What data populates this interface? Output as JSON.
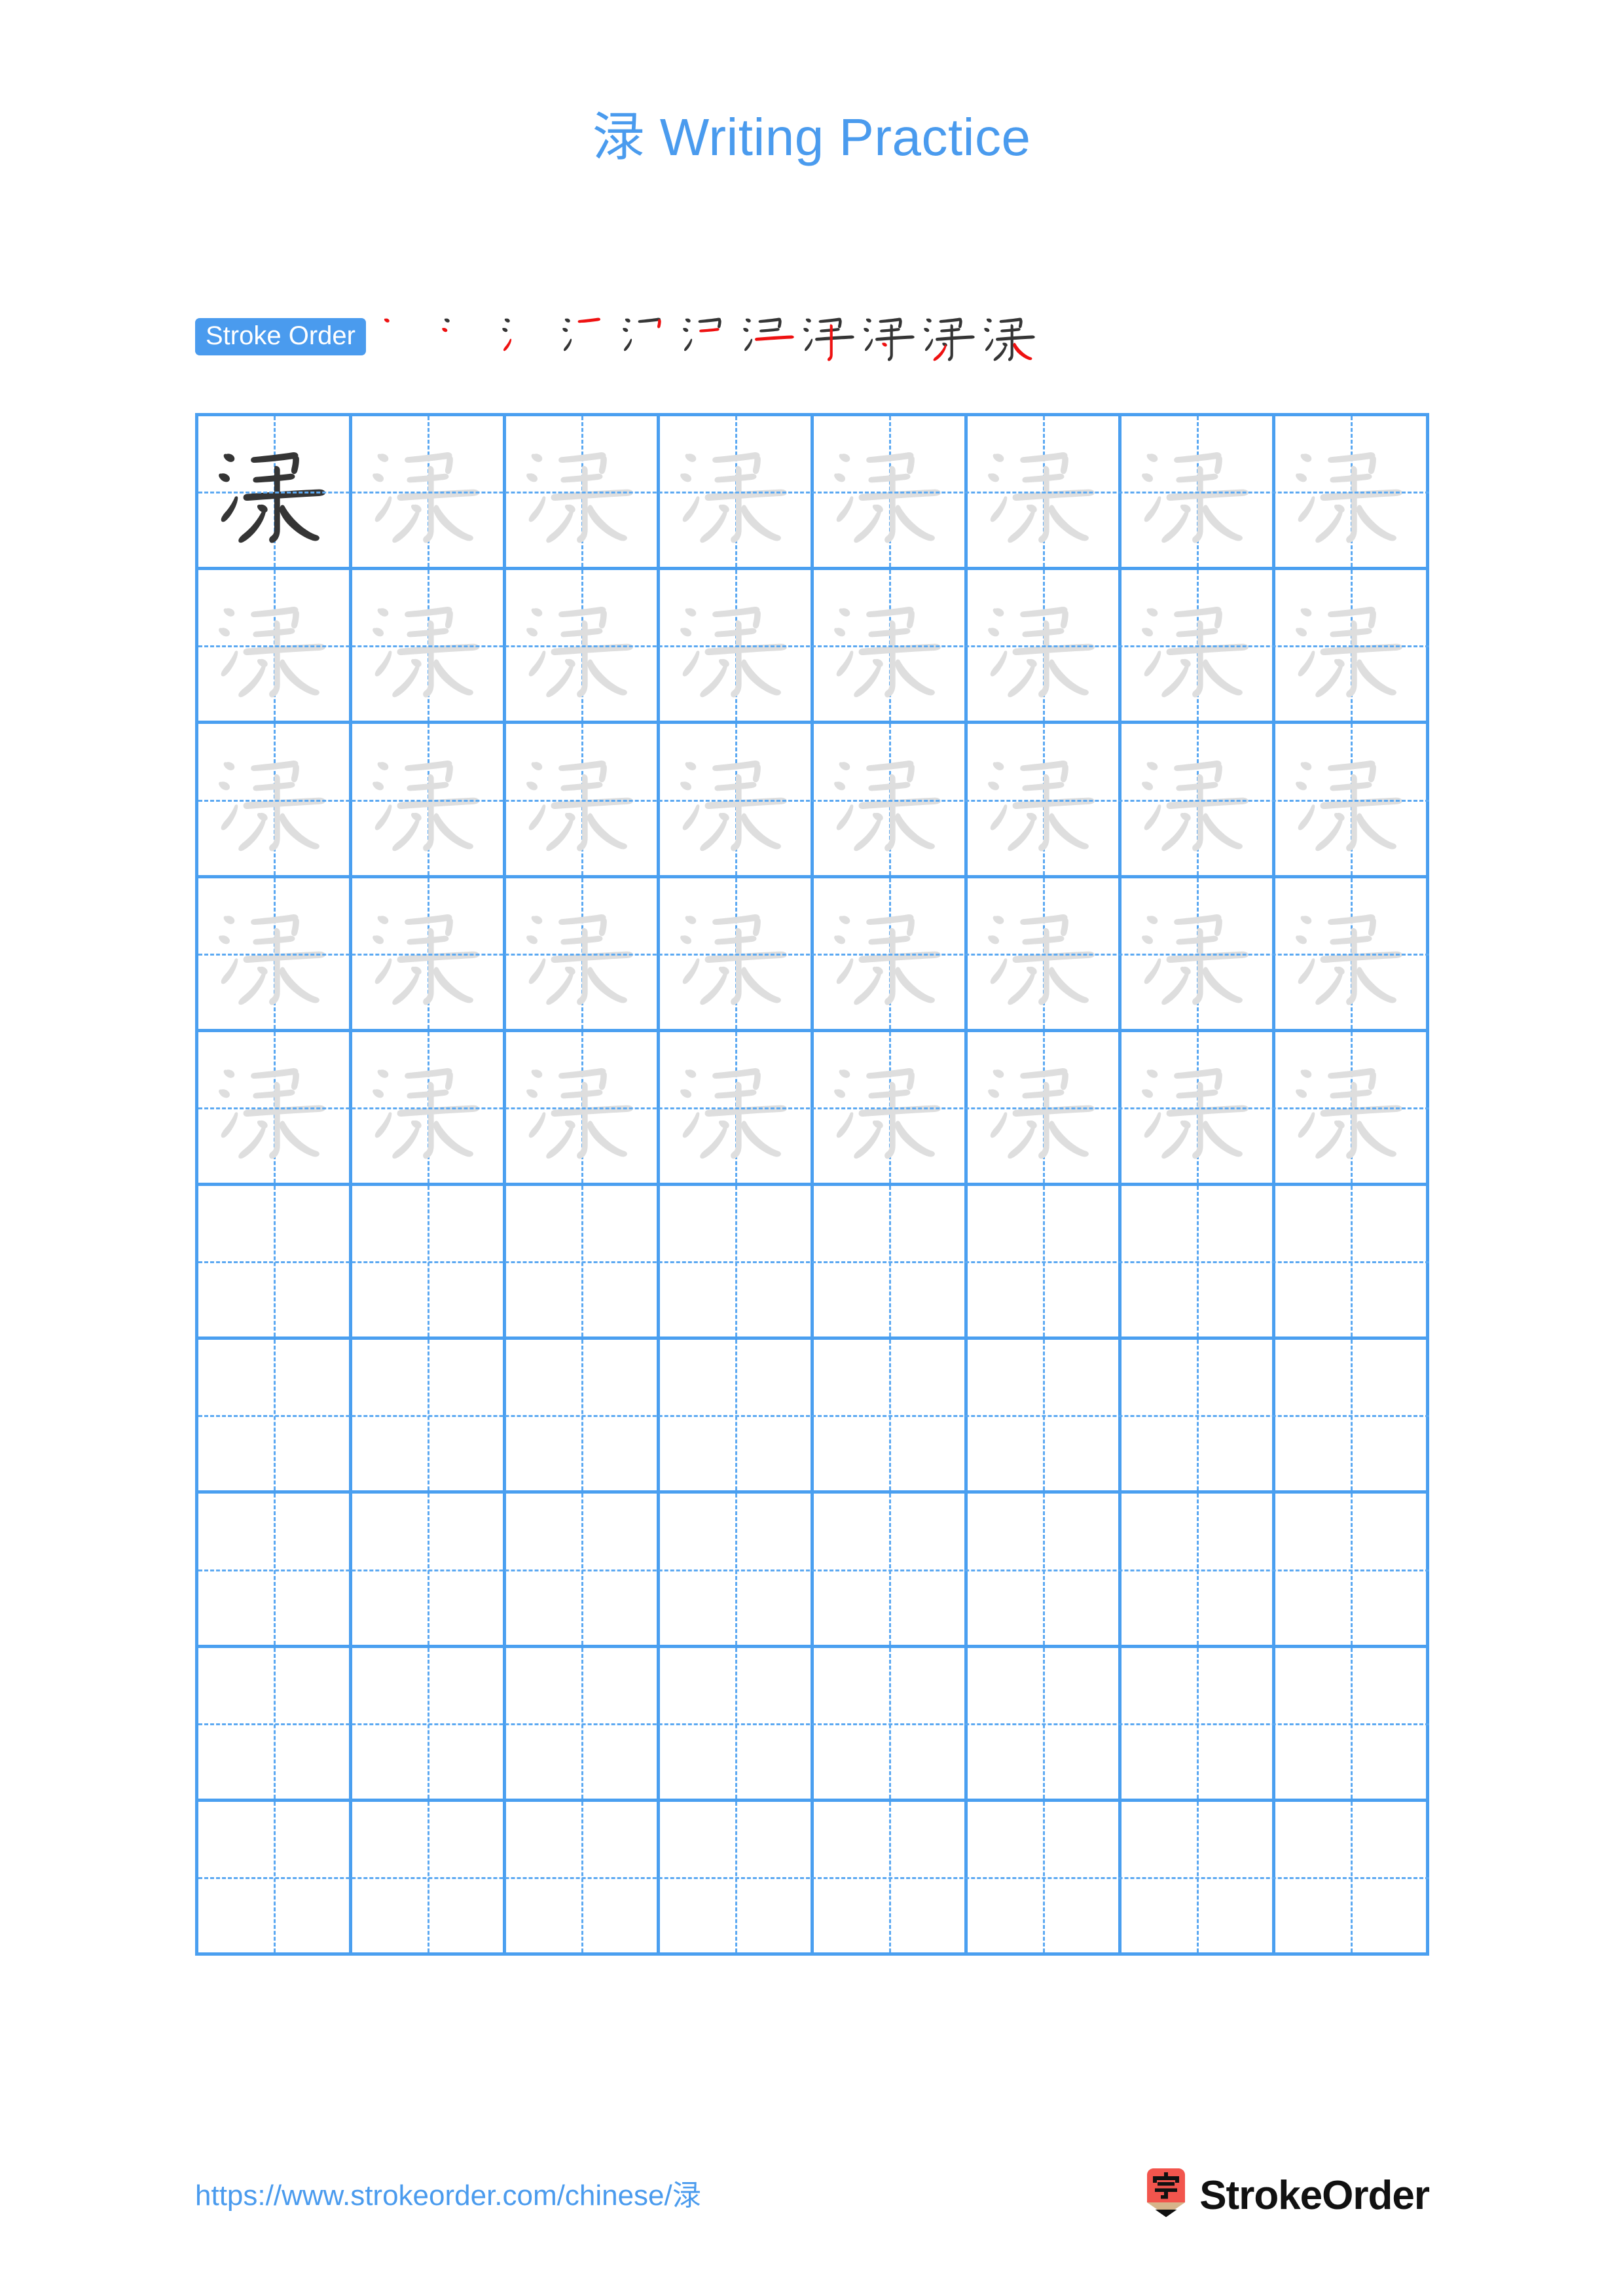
{
  "document": {
    "character": "渌",
    "title": "渌 Writing Practice",
    "title_color": "#4A9BEE",
    "page_background": "#ffffff"
  },
  "stroke_order": {
    "badge_label": "Stroke Order",
    "badge_background": "#4A9BEE",
    "badge_text_color": "#ffffff",
    "new_stroke_color": "#ee1111",
    "existing_stroke_color": "#353535",
    "total_strokes": 11,
    "stages": [
      {
        "index": 1,
        "strokes_shown": 1,
        "new_stroke": 1
      },
      {
        "index": 2,
        "strokes_shown": 2,
        "new_stroke": 2
      },
      {
        "index": 3,
        "strokes_shown": 3,
        "new_stroke": 3
      },
      {
        "index": 4,
        "strokes_shown": 4,
        "new_stroke": 4
      },
      {
        "index": 5,
        "strokes_shown": 5,
        "new_stroke": 5
      },
      {
        "index": 6,
        "strokes_shown": 6,
        "new_stroke": 6
      },
      {
        "index": 7,
        "strokes_shown": 7,
        "new_stroke": 7
      },
      {
        "index": 8,
        "strokes_shown": 8,
        "new_stroke": 8
      },
      {
        "index": 9,
        "strokes_shown": 9,
        "new_stroke": 9
      },
      {
        "index": 10,
        "strokes_shown": 10,
        "new_stroke": 10
      },
      {
        "index": 11,
        "strokes_shown": 11,
        "new_stroke": 11
      }
    ]
  },
  "grid": {
    "columns": 8,
    "rows": 10,
    "border_color": "#4A9FF0",
    "guide_color": "#5CA9F2",
    "dark_glyph_color": "#353535",
    "light_glyph_color": "#dedede",
    "rows_data": [
      {
        "row": 1,
        "cells": [
          "dark",
          "light",
          "light",
          "light",
          "light",
          "light",
          "light",
          "light"
        ]
      },
      {
        "row": 2,
        "cells": [
          "light",
          "light",
          "light",
          "light",
          "light",
          "light",
          "light",
          "light"
        ]
      },
      {
        "row": 3,
        "cells": [
          "light",
          "light",
          "light",
          "light",
          "light",
          "light",
          "light",
          "light"
        ]
      },
      {
        "row": 4,
        "cells": [
          "light",
          "light",
          "light",
          "light",
          "light",
          "light",
          "light",
          "light"
        ]
      },
      {
        "row": 5,
        "cells": [
          "light",
          "light",
          "light",
          "light",
          "light",
          "light",
          "light",
          "light"
        ]
      },
      {
        "row": 6,
        "cells": [
          "empty",
          "empty",
          "empty",
          "empty",
          "empty",
          "empty",
          "empty",
          "empty"
        ]
      },
      {
        "row": 7,
        "cells": [
          "empty",
          "empty",
          "empty",
          "empty",
          "empty",
          "empty",
          "empty",
          "empty"
        ]
      },
      {
        "row": 8,
        "cells": [
          "empty",
          "empty",
          "empty",
          "empty",
          "empty",
          "empty",
          "empty",
          "empty"
        ]
      },
      {
        "row": 9,
        "cells": [
          "empty",
          "empty",
          "empty",
          "empty",
          "empty",
          "empty",
          "empty",
          "empty"
        ]
      },
      {
        "row": 10,
        "cells": [
          "empty",
          "empty",
          "empty",
          "empty",
          "empty",
          "empty",
          "empty",
          "empty"
        ]
      }
    ]
  },
  "footer": {
    "url": "https://www.strokeorder.com/chinese/渌",
    "url_color": "#4A9BEE",
    "brand_name": "StrokeOrder",
    "logo_character": "字",
    "logo_body_color": "#f2554d",
    "logo_wood_color": "#d6b48a",
    "logo_tip_color": "#111111"
  }
}
